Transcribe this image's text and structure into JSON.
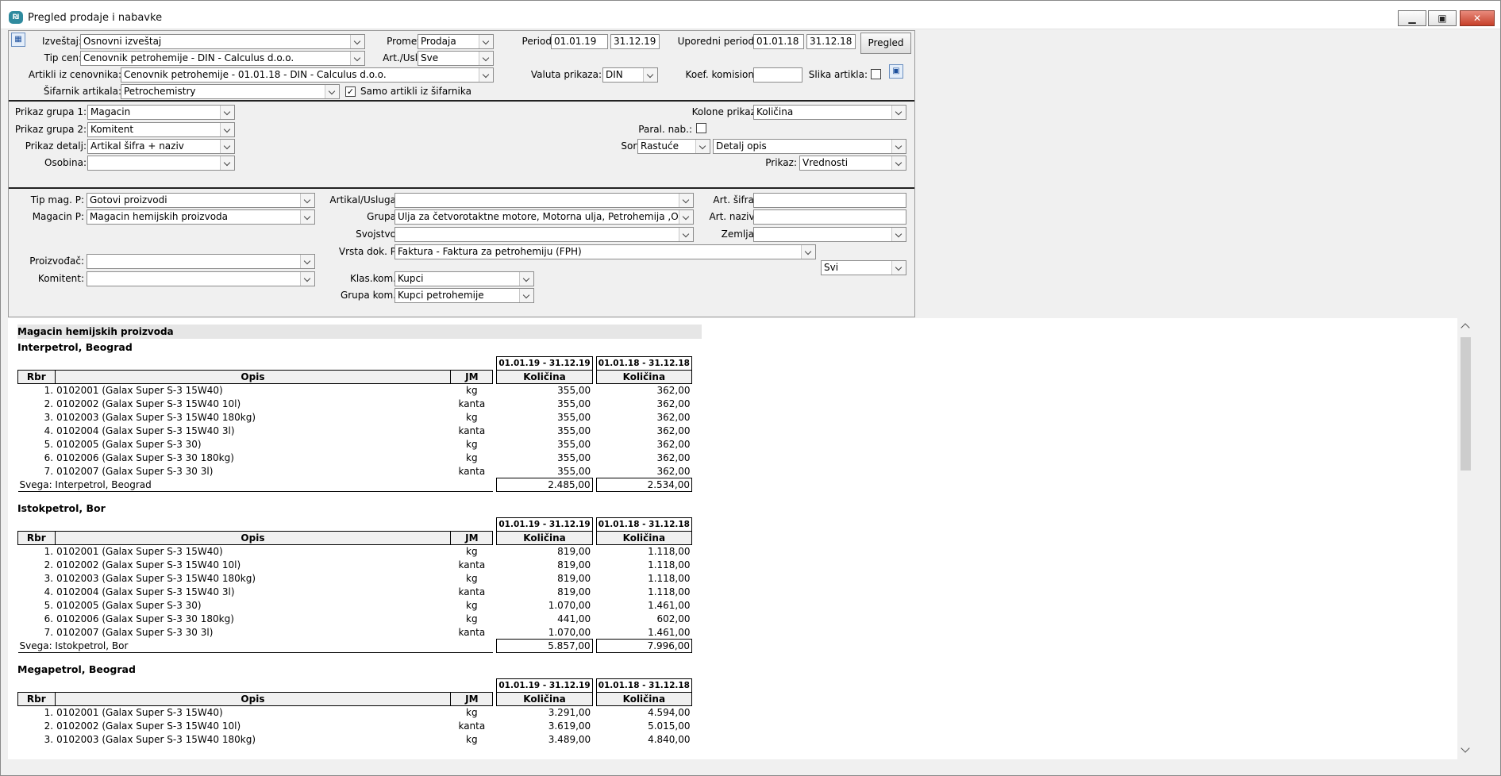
{
  "window": {
    "title": "Pregled prodaje i nabavke",
    "app_icon_text": "₪"
  },
  "form": {
    "izvestaj": {
      "label": "Izveštaj:",
      "value": "Osnovni izveštaj"
    },
    "promet": {
      "label": "Promet:",
      "value": "Prodaja"
    },
    "period": {
      "label": "Period:",
      "from": "01.01.19",
      "to": "31.12.19"
    },
    "uporedni_period": {
      "label": "Uporedni period:",
      "from": "01.01.18",
      "to": "31.12.18"
    },
    "pregled_button": "Pregled",
    "tip_cen": {
      "label": "Tip cen:",
      "value": "Cenovnik petrohemije - DIN - Calculus d.o.o."
    },
    "art_usl": {
      "label": "Art./Usl.:",
      "value": "Sve"
    },
    "artikli_iz_cenovnika": {
      "label": "Artikli iz cenovnika:",
      "value": "Cenovnik petrohemije - 01.01.18 - DIN - Calculus d.o.o."
    },
    "valuta_prikaza": {
      "label": "Valuta prikaza:",
      "value": "DIN"
    },
    "koef_komision": {
      "label": "Koef. komision:",
      "value": ""
    },
    "slika_artikla": {
      "label": "Slika artikla:"
    },
    "sifarnik_artikala": {
      "label": "Šifarnik artikala:",
      "value": "Petrochemistry"
    },
    "samo_artikli": {
      "label": "Samo artikli iz šifarnika",
      "check": "✓"
    },
    "prikaz_grupa_1": {
      "label": "Prikaz grupa 1:",
      "value": "Magacin"
    },
    "prikaz_grupa_2": {
      "label": "Prikaz grupa 2:",
      "value": "Komitent"
    },
    "prikaz_detalj": {
      "label": "Prikaz detalj:",
      "value": "Artikal šifra + naziv"
    },
    "osobina": {
      "label": "Osobina:",
      "value": ""
    },
    "kolone_prikaz": {
      "label": "Kolone prikaz:",
      "value": "Količina"
    },
    "paral_nab": {
      "label": "Paral. nab.:"
    },
    "sort": {
      "label": "Sort:",
      "order": "Rastuće",
      "by": "Detalj opis"
    },
    "prikaz": {
      "label": "Prikaz:",
      "value": "Vrednosti"
    },
    "tip_mag_p": {
      "label": "Tip mag. P:",
      "value": "Gotovi proizvodi"
    },
    "magacin_p": {
      "label": "Magacin P:",
      "value": "Magacin hemijskih proizvoda"
    },
    "proizvodjac": {
      "label": "Proizvođač:",
      "value": ""
    },
    "komitent": {
      "label": "Komitent:",
      "value": ""
    },
    "artikal_usluga": {
      "label": "Artikal/Usluga:",
      "value": ""
    },
    "grupa": {
      "label": "Grupa:",
      "value": "Ulja za četvorotaktne motore, Motorna ulja, Petrohemija ,O"
    },
    "svojstvo": {
      "label": "Svojstvo:",
      "value": ""
    },
    "vrsta_dok_p": {
      "label": "Vrsta dok. P:",
      "value": "Faktura  -  Faktura za petrohemiju (FPH)"
    },
    "klas_kom": {
      "label": "Klas.kom.:",
      "value": "Kupci"
    },
    "grupa_kom": {
      "label": "Grupa kom.:",
      "value": "Kupci petrohemije"
    },
    "art_sifra": {
      "label": "Art. šifra:",
      "value": ""
    },
    "art_naziv": {
      "label": "Art. naziv:",
      "value": ""
    },
    "zemlja": {
      "label": "Zemlja:",
      "value": ""
    },
    "svi": {
      "value": "Svi"
    }
  },
  "report": {
    "warehouse": "Magacin hemijskih proizvoda",
    "headers": {
      "rbr": "Rbr",
      "opis": "Opis",
      "jm": "JM",
      "q1": "Količina",
      "q2": "Količina"
    },
    "periods": {
      "p1": "01.01.19 - 31.12.19",
      "p2": "01.01.18 - 31.12.18"
    },
    "groups": [
      {
        "name": "Interpetrol, Beograd",
        "rows": [
          {
            "rbr": "1.",
            "opis": "0102001 (Galax Super S-3 15W40)",
            "jm": "kg",
            "q1": "355,00",
            "q2": "362,00"
          },
          {
            "rbr": "2.",
            "opis": "0102002 (Galax Super S-3 15W40 10l)",
            "jm": "kanta",
            "q1": "355,00",
            "q2": "362,00"
          },
          {
            "rbr": "3.",
            "opis": "0102003 (Galax Super S-3 15W40 180kg)",
            "jm": "kg",
            "q1": "355,00",
            "q2": "362,00"
          },
          {
            "rbr": "4.",
            "opis": "0102004 (Galax Super S-3 15W40 3l)",
            "jm": "kanta",
            "q1": "355,00",
            "q2": "362,00"
          },
          {
            "rbr": "5.",
            "opis": "0102005 (Galax Super S-3 30)",
            "jm": "kg",
            "q1": "355,00",
            "q2": "362,00"
          },
          {
            "rbr": "6.",
            "opis": "0102006 (Galax Super S-3 30 180kg)",
            "jm": "kg",
            "q1": "355,00",
            "q2": "362,00"
          },
          {
            "rbr": "7.",
            "opis": "0102007 (Galax Super S-3 30 3l)",
            "jm": "kanta",
            "q1": "355,00",
            "q2": "362,00"
          }
        ],
        "total_label": "Svega: Interpetrol, Beograd",
        "total_q1": "2.485,00",
        "total_q2": "2.534,00"
      },
      {
        "name": "Istokpetrol, Bor",
        "rows": [
          {
            "rbr": "1.",
            "opis": "0102001 (Galax Super S-3 15W40)",
            "jm": "kg",
            "q1": "819,00",
            "q2": "1.118,00"
          },
          {
            "rbr": "2.",
            "opis": "0102002 (Galax Super S-3 15W40 10l)",
            "jm": "kanta",
            "q1": "819,00",
            "q2": "1.118,00"
          },
          {
            "rbr": "3.",
            "opis": "0102003 (Galax Super S-3 15W40 180kg)",
            "jm": "kg",
            "q1": "819,00",
            "q2": "1.118,00"
          },
          {
            "rbr": "4.",
            "opis": "0102004 (Galax Super S-3 15W40 3l)",
            "jm": "kanta",
            "q1": "819,00",
            "q2": "1.118,00"
          },
          {
            "rbr": "5.",
            "opis": "0102005 (Galax Super S-3 30)",
            "jm": "kg",
            "q1": "1.070,00",
            "q2": "1.461,00"
          },
          {
            "rbr": "6.",
            "opis": "0102006 (Galax Super S-3 30 180kg)",
            "jm": "kg",
            "q1": "441,00",
            "q2": "602,00"
          },
          {
            "rbr": "7.",
            "opis": "0102007 (Galax Super S-3 30 3l)",
            "jm": "kanta",
            "q1": "1.070,00",
            "q2": "1.461,00"
          }
        ],
        "total_label": "Svega: Istokpetrol, Bor",
        "total_q1": "5.857,00",
        "total_q2": "7.996,00"
      },
      {
        "name": "Megapetrol, Beograd",
        "rows": [
          {
            "rbr": "1.",
            "opis": "0102001 (Galax Super S-3 15W40)",
            "jm": "kg",
            "q1": "3.291,00",
            "q2": "4.594,00"
          },
          {
            "rbr": "2.",
            "opis": "0102002 (Galax Super S-3 15W40 10l)",
            "jm": "kanta",
            "q1": "3.619,00",
            "q2": "5.015,00"
          },
          {
            "rbr": "3.",
            "opis": "0102003 (Galax Super S-3 15W40 180kg)",
            "jm": "kg",
            "q1": "3.489,00",
            "q2": "4.840,00"
          }
        ]
      }
    ]
  }
}
